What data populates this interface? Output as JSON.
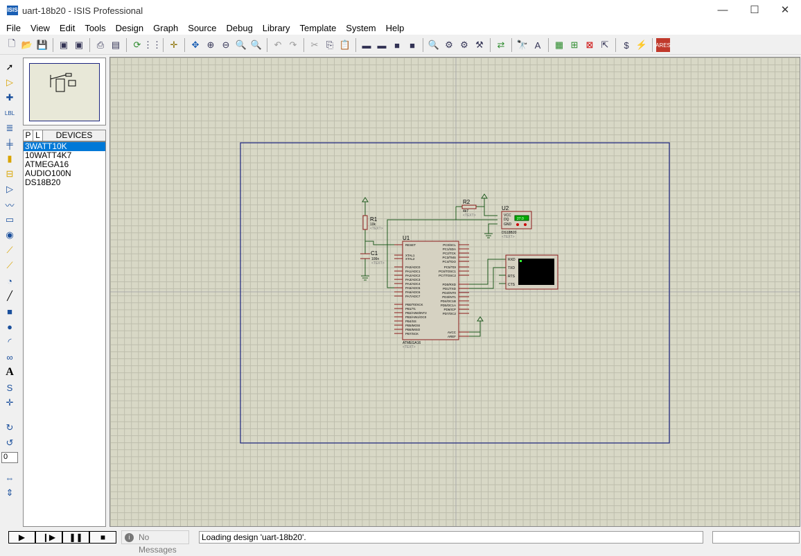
{
  "window": {
    "title": "uart-18b20 - ISIS Professional",
    "app_icon": "ISIS",
    "min": "—",
    "max": "☐",
    "close": "✕"
  },
  "menu": [
    "File",
    "Edit",
    "View",
    "Tools",
    "Design",
    "Graph",
    "Source",
    "Debug",
    "Library",
    "Template",
    "System",
    "Help"
  ],
  "device_panel": {
    "p_label": "P",
    "l_label": "L",
    "title": "DEVICES",
    "items": [
      "3WATT10K",
      "10WATT4K7",
      "ATMEGA16",
      "AUDIO100N",
      "DS18B20"
    ],
    "selected": 0
  },
  "rotation_value": "0",
  "schematic": {
    "r1": {
      "ref": "R1",
      "value": "10k",
      "text": "<TEXT>"
    },
    "r2": {
      "ref": "R2",
      "value": "4k7",
      "text": "<TEXT>"
    },
    "c1": {
      "ref": "C1",
      "value": "100n",
      "text": "<TEXT>"
    },
    "u1": {
      "ref": "U1",
      "part": "ATMEGA16",
      "text": "<TEXT>",
      "left_pins": [
        "RESET",
        "XTAL1",
        "XTAL2",
        "PA0/ADC0",
        "PA1/ADC1",
        "PA2/ADC2",
        "PA3/ADC3",
        "PA4/ADC4",
        "PA5/ADC5",
        "PA6/ADC6",
        "PA7/ADC7",
        "PB0/T0/XCK",
        "PB1/T1",
        "PB2/AIN0/INT2",
        "PB3/AIN1/OC0",
        "PB4/SS",
        "PB5/MOSI",
        "PB6/MISO",
        "PB7/SCK"
      ],
      "right_pins": [
        "PC0/SCL",
        "PC1/SDA",
        "PC2/TCK",
        "PC3/TMS",
        "PC4/TDO",
        "PC5/TDI",
        "PC6/TOSC1",
        "PC7/TOSC2",
        "PD0/RXD",
        "PD1/TXD",
        "PD2/INT0",
        "PD3/INT1",
        "PD4/OC1B",
        "PD5/OC1A",
        "PD6/ICP",
        "PD7/OC2",
        "AVCC",
        "AREF"
      ]
    },
    "u2": {
      "ref": "U2",
      "part": "DS18B20",
      "text": "<TEXT>",
      "pins": [
        "VCC",
        "DQ",
        "GND"
      ],
      "display": "27.0"
    },
    "terminal": {
      "pins": [
        "RXD",
        "TXD",
        "RTS",
        "CTS"
      ]
    }
  },
  "status": {
    "messages": "No Messages",
    "text": "Loading design 'uart-18b20'."
  },
  "colors": {
    "grid_bg": "#d8d8c6",
    "sheet_border": "#1a237e",
    "wire": "#1f5a1f",
    "component": "#8b1a1a",
    "selection": "#0078d7"
  }
}
